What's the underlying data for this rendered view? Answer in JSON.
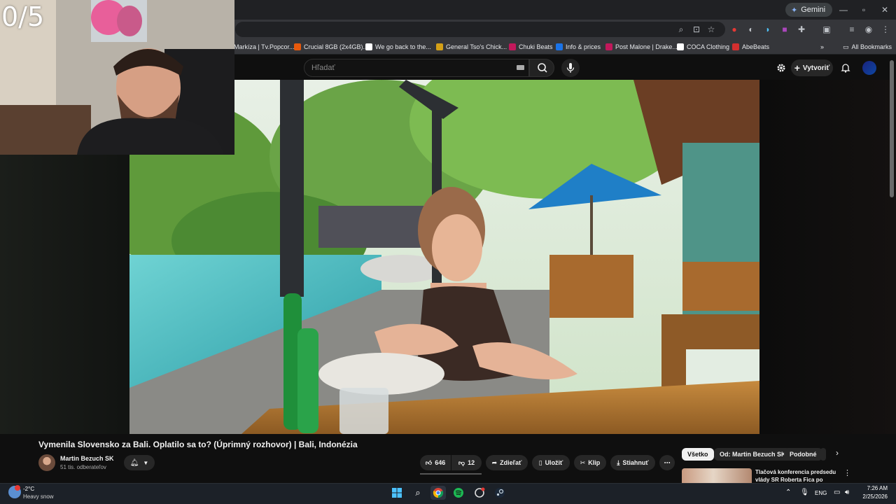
{
  "browser": {
    "gemini_label": "Gemini",
    "bookmarks": [
      {
        "label": "Markíza | Tv.Popcor...",
        "color": "#ffffff"
      },
      {
        "label": "Crucial 8GB (2x4GB)...",
        "color": "#e8590c"
      },
      {
        "label": "We go back to the...",
        "color": "#ffffff"
      },
      {
        "label": "General Tso's Chick...",
        "color": "#d4a017"
      },
      {
        "label": "Chuki Beats",
        "color": "#c2185b"
      },
      {
        "label": "Info & prices",
        "color": "#1a73e8"
      },
      {
        "label": "Post Malone | Drake...",
        "color": "#c2185b"
      },
      {
        "label": "COCA Clothing",
        "color": "#ffffff"
      },
      {
        "label": "AbeBeats",
        "color": "#d32f2f"
      }
    ],
    "all_bookmarks": "All Bookmarks"
  },
  "overlay": {
    "counter": "0/5"
  },
  "youtube": {
    "search_placeholder": "Hľadať",
    "create_label": "Vytvoriť",
    "video_title": "Vymenila Slovensko za Bali. Oplatilo sa to? (Úprimný rozhovor) | Bali, Indonézia",
    "channel_name": "Martin Bezuch SK",
    "subscribers": "51 tis. odberateľov",
    "likes": "646",
    "dislikes": "12",
    "share": "Zdieľať",
    "save": "Uložiť",
    "clip": "Klip",
    "download": "Stiahnuť",
    "chips": [
      "Všetko",
      "Od: Martin Bezuch SK",
      "Podobné"
    ],
    "recommended_title": "Tlačová konferencia predsedu vlády SR Roberta Fica po"
  },
  "taskbar": {
    "temperature": "-2°C",
    "weather": "Heavy snow",
    "language": "ENG",
    "time": "7:26 AM",
    "date": "2/25/2026"
  }
}
